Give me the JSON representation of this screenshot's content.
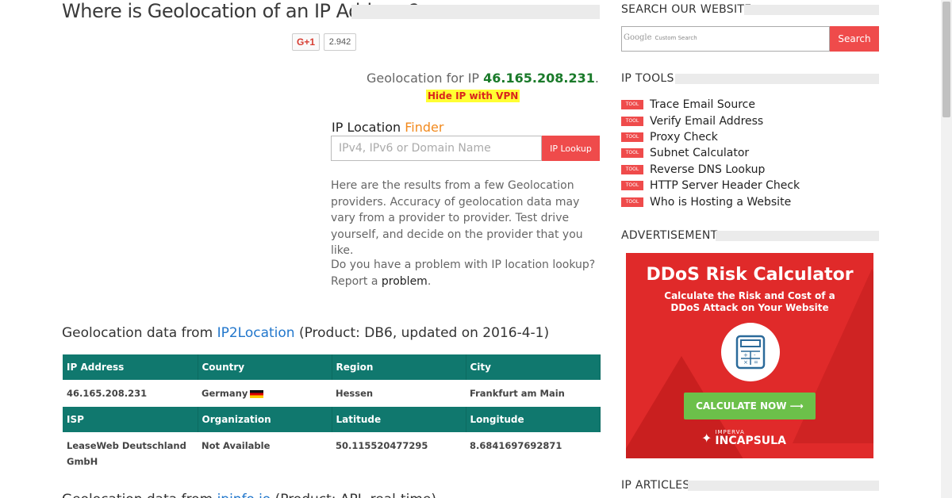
{
  "page": {
    "title": "Where is Geolocation of an IP Address?"
  },
  "share": {
    "gplus_label": "G+1",
    "count": "2.942"
  },
  "lookup": {
    "geo_prefix": "Geolocation for IP ",
    "ip": "46.165.208.231",
    "geo_suffix": ".",
    "hide_vpn": "Hide IP with VPN",
    "finder_label_a": "IP Location ",
    "finder_label_b": "Finder",
    "input_placeholder": "IPv4, IPv6 or Domain Name",
    "button_label": "IP Lookup",
    "intro": "Here are the results from a few Geolocation providers. Accuracy of geolocation data may vary from a provider to provider. Test drive yourself, and decide on the provider that you like.",
    "problem_text": "Do you have a problem with IP location lookup? Report a ",
    "problem_link": "problem",
    "problem_end": "."
  },
  "section1": {
    "prefix": "Geolocation data from ",
    "provider": "IP2Location",
    "suffix": " (Product: DB6, updated on 2016-4-1)"
  },
  "section2": {
    "prefix": "Geolocation data from ",
    "provider": "ipinfo.io",
    "suffix": " (Product: API, real-time)"
  },
  "table": {
    "headers1": [
      "IP Address",
      "Country",
      "Region",
      "City"
    ],
    "row1": [
      "46.165.208.231",
      "Germany",
      "Hessen",
      "Frankfurt am Main"
    ],
    "headers2": [
      "ISP",
      "Organization",
      "Latitude",
      "Longitude"
    ],
    "row2": [
      "LeaseWeb Deutschland GmbH",
      "Not Available",
      "50.115520477295",
      "8.6841697692871"
    ]
  },
  "sidebar": {
    "search_heading": "SEARCH OUR WEBSITE",
    "google_label": "Google",
    "custom_search": "Custom Search",
    "search_button": "Search",
    "tools_heading": "IP TOOLS",
    "tool_badge": "TOOL",
    "tools": [
      "Trace Email Source",
      "Verify Email Address",
      "Proxy Check",
      "Subnet Calculator",
      "Reverse DNS Lookup",
      "HTTP Server Header Check",
      "Who is Hosting a Website"
    ],
    "ad_heading": "ADVERTISEMENT",
    "articles_heading": "IP ARTICLES"
  },
  "ad": {
    "title": "DDoS Risk Calculator",
    "subtitle": "Calculate the Risk and Cost of a DDoS Attack on Your Website",
    "button": "CALCULATE NOW",
    "brand_small": "IMPERVA",
    "brand_big": "INCAPSULA"
  },
  "colors": {
    "accent_red": "#ef4b4b",
    "table_teal": "#10786e",
    "link_blue": "#2277cc",
    "ip_green": "#1a7a2a"
  }
}
